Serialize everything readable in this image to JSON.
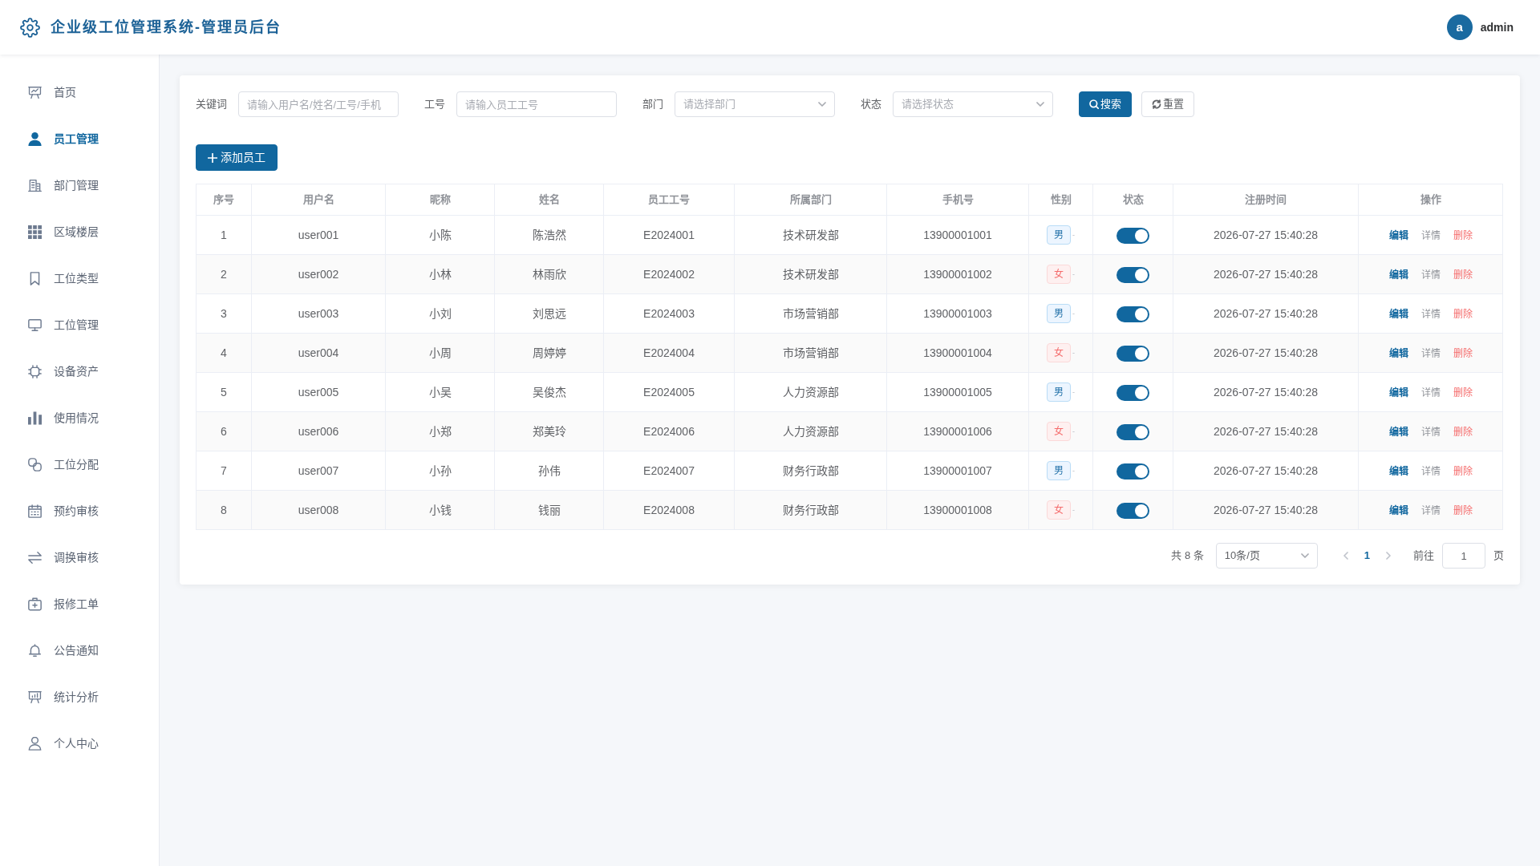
{
  "header": {
    "title": "企业级工位管理系统-管理员后台",
    "user": {
      "avatar_letter": "a",
      "name": "admin"
    }
  },
  "sidebar": {
    "items": [
      {
        "label": "首页",
        "selected": false
      },
      {
        "label": "员工管理",
        "selected": true
      },
      {
        "label": "部门管理",
        "selected": false
      },
      {
        "label": "区域楼层",
        "selected": false
      },
      {
        "label": "工位类型",
        "selected": false
      },
      {
        "label": "工位管理",
        "selected": false
      },
      {
        "label": "设备资产",
        "selected": false
      },
      {
        "label": "使用情况",
        "selected": false
      },
      {
        "label": "工位分配",
        "selected": false
      },
      {
        "label": "预约审核",
        "selected": false
      },
      {
        "label": "调换审核",
        "selected": false
      },
      {
        "label": "报修工单",
        "selected": false
      },
      {
        "label": "公告通知",
        "selected": false
      },
      {
        "label": "统计分析",
        "selected": false
      },
      {
        "label": "个人中心",
        "selected": false
      }
    ]
  },
  "filters": [
    {
      "kind": "input",
      "label": "关键词",
      "placeholder": "请输入用户名/姓名/工号/手机"
    },
    {
      "kind": "input",
      "label": "工号",
      "placeholder": "请输入员工工号"
    },
    {
      "kind": "select",
      "label": "部门",
      "placeholder": "请选择部门"
    },
    {
      "kind": "select",
      "label": "状态",
      "placeholder": "请选择状态"
    }
  ],
  "filter_buttons": [
    {
      "kind": "search",
      "label": "搜索"
    },
    {
      "kind": "reset",
      "label": "重置"
    }
  ],
  "add_button": {
    "label": "添加员工"
  },
  "table": {
    "columns": [
      "序号",
      "用户名",
      "昵称",
      "姓名",
      "员工工号",
      "所属部门",
      "手机号",
      "性别",
      "状态",
      "注册时间",
      "操作"
    ],
    "rows": [
      {
        "index": "1",
        "username": "user001",
        "nickname": "小陈",
        "name": "陈浩然",
        "employee_id": "E2024001",
        "department": "技术研发部",
        "phone": "13900001001",
        "gender": {
          "text": "男",
          "kind": "male",
          "suffix": "-"
        },
        "enabled": true,
        "registered": "2026-07-27 15:40:28",
        "actions": [
          {
            "kind": "edit",
            "label": "编辑"
          },
          {
            "kind": "detail",
            "label": "详情"
          },
          {
            "kind": "delete",
            "label": "删除"
          }
        ]
      },
      {
        "index": "2",
        "username": "user002",
        "nickname": "小林",
        "name": "林雨欣",
        "employee_id": "E2024002",
        "department": "技术研发部",
        "phone": "13900001002",
        "gender": {
          "text": "女",
          "kind": "female",
          "suffix": "-"
        },
        "enabled": true,
        "registered": "2026-07-27 15:40:28",
        "actions": [
          {
            "kind": "edit",
            "label": "编辑"
          },
          {
            "kind": "detail",
            "label": "详情"
          },
          {
            "kind": "delete",
            "label": "删除"
          }
        ]
      },
      {
        "index": "3",
        "username": "user003",
        "nickname": "小刘",
        "name": "刘思远",
        "employee_id": "E2024003",
        "department": "市场营销部",
        "phone": "13900001003",
        "gender": {
          "text": "男",
          "kind": "male",
          "suffix": "-"
        },
        "enabled": true,
        "registered": "2026-07-27 15:40:28",
        "actions": [
          {
            "kind": "edit",
            "label": "编辑"
          },
          {
            "kind": "detail",
            "label": "详情"
          },
          {
            "kind": "delete",
            "label": "删除"
          }
        ]
      },
      {
        "index": "4",
        "username": "user004",
        "nickname": "小周",
        "name": "周婷婷",
        "employee_id": "E2024004",
        "department": "市场营销部",
        "phone": "13900001004",
        "gender": {
          "text": "女",
          "kind": "female",
          "suffix": "-"
        },
        "enabled": true,
        "registered": "2026-07-27 15:40:28",
        "actions": [
          {
            "kind": "edit",
            "label": "编辑"
          },
          {
            "kind": "detail",
            "label": "详情"
          },
          {
            "kind": "delete",
            "label": "删除"
          }
        ]
      },
      {
        "index": "5",
        "username": "user005",
        "nickname": "小吴",
        "name": "吴俊杰",
        "employee_id": "E2024005",
        "department": "人力资源部",
        "phone": "13900001005",
        "gender": {
          "text": "男",
          "kind": "male",
          "suffix": "-"
        },
        "enabled": true,
        "registered": "2026-07-27 15:40:28",
        "actions": [
          {
            "kind": "edit",
            "label": "编辑"
          },
          {
            "kind": "detail",
            "label": "详情"
          },
          {
            "kind": "delete",
            "label": "删除"
          }
        ]
      },
      {
        "index": "6",
        "username": "user006",
        "nickname": "小郑",
        "name": "郑美玲",
        "employee_id": "E2024006",
        "department": "人力资源部",
        "phone": "13900001006",
        "gender": {
          "text": "女",
          "kind": "female",
          "suffix": "-"
        },
        "enabled": true,
        "registered": "2026-07-27 15:40:28",
        "actions": [
          {
            "kind": "edit",
            "label": "编辑"
          },
          {
            "kind": "detail",
            "label": "详情"
          },
          {
            "kind": "delete",
            "label": "删除"
          }
        ]
      },
      {
        "index": "7",
        "username": "user007",
        "nickname": "小孙",
        "name": "孙伟",
        "employee_id": "E2024007",
        "department": "财务行政部",
        "phone": "13900001007",
        "gender": {
          "text": "男",
          "kind": "male",
          "suffix": "-"
        },
        "enabled": true,
        "registered": "2026-07-27 15:40:28",
        "actions": [
          {
            "kind": "edit",
            "label": "编辑"
          },
          {
            "kind": "detail",
            "label": "详情"
          },
          {
            "kind": "delete",
            "label": "删除"
          }
        ]
      },
      {
        "index": "8",
        "username": "user008",
        "nickname": "小钱",
        "name": "钱丽",
        "employee_id": "E2024008",
        "department": "财务行政部",
        "phone": "13900001008",
        "gender": {
          "text": "女",
          "kind": "female",
          "suffix": "-"
        },
        "enabled": true,
        "registered": "2026-07-27 15:40:28",
        "actions": [
          {
            "kind": "edit",
            "label": "编辑"
          },
          {
            "kind": "detail",
            "label": "详情"
          },
          {
            "kind": "delete",
            "label": "删除"
          }
        ]
      }
    ]
  },
  "pagination": {
    "total": "共 8 条",
    "page_size": "10条/页",
    "pages": [
      {
        "label": "1",
        "selected": true
      }
    ],
    "goto_label": "前往",
    "goto_value": "1",
    "page_suffix": "页"
  }
}
